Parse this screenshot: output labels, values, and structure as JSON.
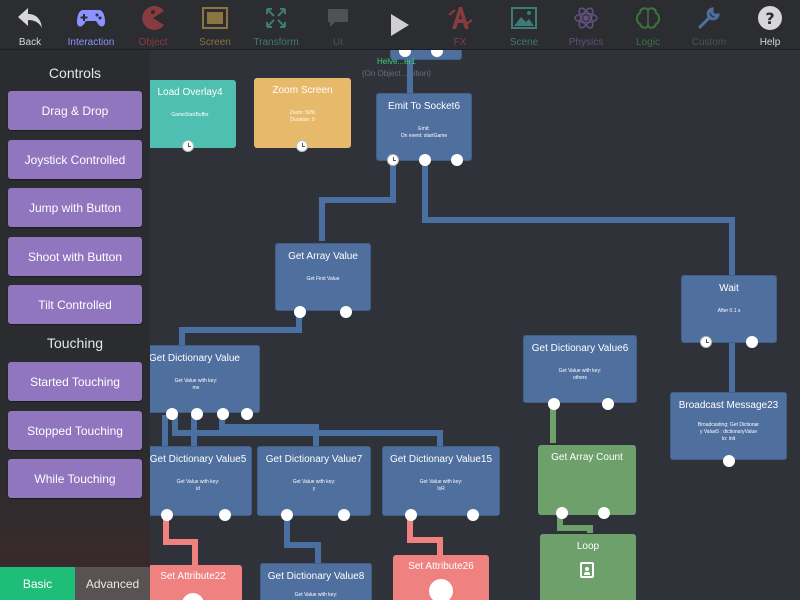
{
  "toolbar": {
    "items": [
      {
        "label": "Back",
        "icon": "back-arrow-icon",
        "color": "white"
      },
      {
        "label": "Interaction",
        "icon": "gamepad-icon",
        "color": "blue"
      },
      {
        "label": "Object",
        "icon": "pacman-icon",
        "color": "red"
      },
      {
        "label": "Screen",
        "icon": "screen-icon",
        "color": "yellow"
      },
      {
        "label": "Transform",
        "icon": "transform-arrows-icon",
        "color": "teal"
      },
      {
        "label": "UI",
        "icon": "speech-bubble-icon",
        "color": "dim"
      },
      {
        "label": "",
        "icon": "play-icon",
        "color": "white"
      },
      {
        "label": "FX",
        "icon": "fx-icon",
        "color": "red"
      },
      {
        "label": "Scene",
        "icon": "landscape-icon",
        "color": "teal"
      },
      {
        "label": "Physics",
        "icon": "atom-icon",
        "color": "purple"
      },
      {
        "label": "Logic",
        "icon": "brain-icon",
        "color": "green"
      },
      {
        "label": "Custom",
        "icon": "wrench-icon",
        "color": "dim"
      },
      {
        "label": "Help",
        "icon": "help-icon",
        "color": "white"
      }
    ]
  },
  "panel": {
    "controls_title": "Controls",
    "controls": [
      "Drag & Drop",
      "Joystick Controlled",
      "Jump with Button",
      "Shoot with Button",
      "Tilt Controlled"
    ],
    "touching_title": "Touching",
    "touching": [
      "Started Touching",
      "Stopped Touching",
      "While Touching"
    ],
    "tabs": [
      "Basic",
      "Advanced"
    ]
  },
  "canvas": {
    "top_label": "Helve...er1",
    "top_sublabel": "(On Object ...sition)",
    "nodes": {
      "load_overlay": {
        "title": "Load Overlay4",
        "sub": "GameStartBuffer"
      },
      "zoom_screen": {
        "title": "Zoom Screen",
        "sub": "Zoom: 50%\nDuration: 0"
      },
      "emit_socket": {
        "title": "Emit To Socket6",
        "sub": "Emit:\nOn event: startGame"
      },
      "get_array_value": {
        "title": "Get Array Value",
        "sub": "Get First Value"
      },
      "wait": {
        "title": "Wait",
        "sub": "After 0.1 s"
      },
      "get_dict_value": {
        "title": "Get Dictionary Value",
        "sub": "Get Value with key:\nme"
      },
      "get_dict_value6": {
        "title": "Get Dictionary Value6",
        "sub": "Get Value with key:\nothers"
      },
      "broadcast": {
        "title": "Broadcast Message23",
        "sub": "Broadcasting: Get Dictionar\ny Value5 : dictionaryValue\nto: init"
      },
      "get_dict_value5": {
        "title": "Get Dictionary Value5",
        "sub": "Get Value with key:\nid"
      },
      "get_dict_value7": {
        "title": "Get Dictionary Value7",
        "sub": "Get Value with key:\ny"
      },
      "get_dict_value15": {
        "title": "Get Dictionary Value15",
        "sub": "Get Value with key:\nIsR"
      },
      "get_array_count": {
        "title": "Get Array Count",
        "sub": ""
      },
      "set_attribute22": {
        "title": "Set Attribute22",
        "sub": ""
      },
      "get_dict_value8": {
        "title": "Get Dictionary Value8",
        "sub": "Get Value with key:"
      },
      "set_attribute26": {
        "title": "Set Attribute26",
        "sub": ""
      },
      "loop": {
        "title": "Loop",
        "sub": ""
      }
    }
  }
}
